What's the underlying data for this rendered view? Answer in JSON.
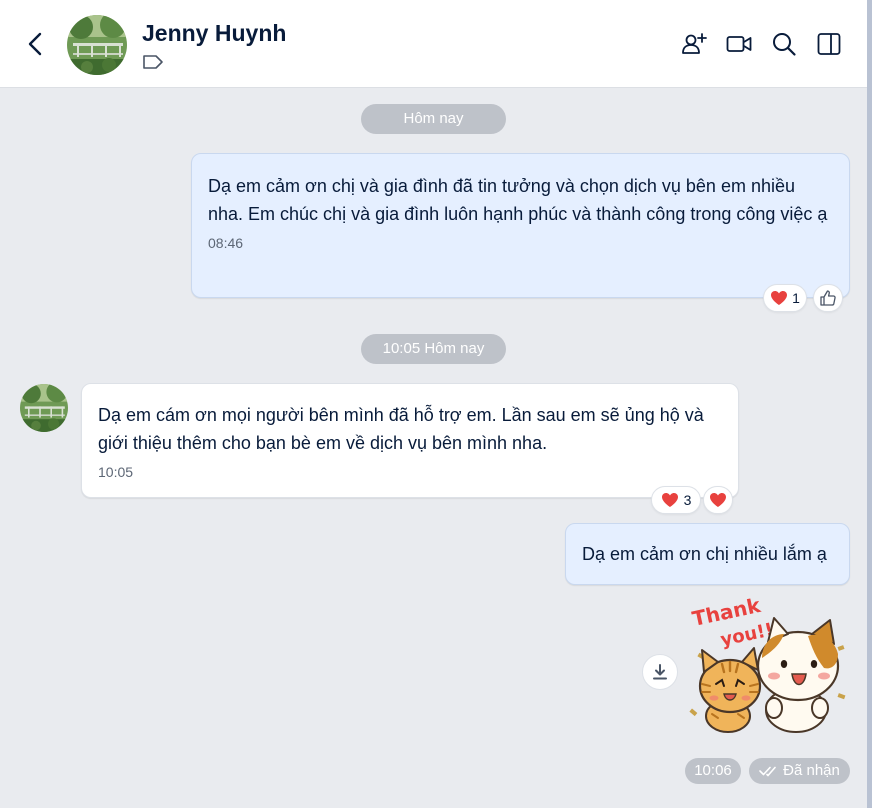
{
  "header": {
    "contact_name": "Jenny Huynh",
    "icons": [
      "back-icon",
      "tag-icon",
      "add-member-icon",
      "video-call-icon",
      "search-icon",
      "sidebar-toggle-icon"
    ]
  },
  "messages": {
    "date_separator_1": "Hôm nay",
    "date_separator_2": "10:05 Hôm nay",
    "msg1": {
      "text": "Dạ em cảm ơn chị và gia đình đã tin tưởng và chọn dịch vụ bên em nhiều nha. Em chúc chị và gia đình luôn hạnh phúc và thành công trong công việc ạ",
      "time": "08:46",
      "reaction_count": "1"
    },
    "msg2": {
      "text": "Dạ em cám ơn mọi người bên mình đã hỗ trợ em. Lần sau em sẽ ủng hộ và giới thiệu thêm cho bạn bè em về dịch vụ bên mình nha.",
      "time": "10:05",
      "reaction_count": "3"
    },
    "msg3": {
      "text": "Dạ em cảm ơn chị nhiều lắm ạ"
    },
    "sticker": {
      "text_line1": "Thank",
      "text_line2": "you!!"
    },
    "last_time": "10:06",
    "status": "Đã nhận"
  },
  "colors": {
    "outgoing_bubble": "#e5efff",
    "incoming_bubble": "#ffffff",
    "chat_background": "#e9ebef",
    "pill": "#bec2c9",
    "heart": "#e8413e"
  }
}
